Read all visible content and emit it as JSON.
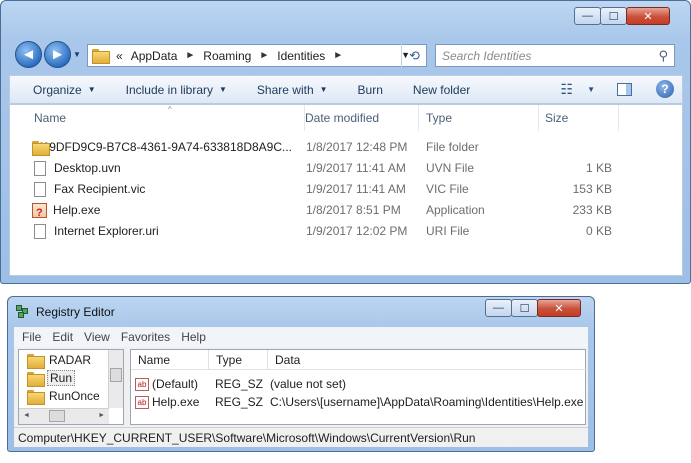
{
  "explorer": {
    "caption_buttons": {
      "minimize": "—",
      "maximize": "☐",
      "close": "✕"
    },
    "nav": {
      "back_glyph": "◄",
      "forward_glyph": "►",
      "dropdown_glyph": "▼"
    },
    "address": {
      "prefix": "«",
      "crumbs": [
        "AppData",
        "Roaming",
        "Identities"
      ],
      "separator": "►",
      "dropdown_glyph": "▼",
      "refresh_glyph": "⟲"
    },
    "search": {
      "placeholder": "Search Identities",
      "icon": "⚲"
    },
    "toolbar": {
      "organize": "Organize",
      "include_in_library": "Include in library",
      "share_with": "Share with",
      "burn": "Burn",
      "new_folder": "New folder",
      "dropdown_glyph": "▼",
      "views_glyph": "☷",
      "help_glyph": "?"
    },
    "columns": {
      "name": "Name",
      "date_modified": "Date modified",
      "type": "Type",
      "size": "Size",
      "sort_indicator": "^"
    },
    "files": [
      {
        "icon": "folder-icon",
        "name": "{69DFD9C9-B7C8-4361-9A74-633818D8A9C...",
        "date": "1/8/2017 12:48 PM",
        "type": "File folder",
        "size": ""
      },
      {
        "icon": "document-icon",
        "name": "Desktop.uvn",
        "date": "1/9/2017 11:41 AM",
        "type": "UVN File",
        "size": "1 KB"
      },
      {
        "icon": "document-icon",
        "name": "Fax Recipient.vic",
        "date": "1/9/2017 11:41 AM",
        "type": "VIC File",
        "size": "153 KB"
      },
      {
        "icon": "application-icon",
        "name": "Help.exe",
        "date": "1/8/2017 8:51 PM",
        "type": "Application",
        "size": "233 KB"
      },
      {
        "icon": "document-icon",
        "name": "Internet Explorer.uri",
        "date": "1/9/2017 12:02 PM",
        "type": "URI File",
        "size": "0 KB"
      }
    ]
  },
  "regedit": {
    "title": "Registry Editor",
    "caption_buttons": {
      "minimize": "—",
      "maximize": "☐",
      "close": "✕"
    },
    "menu": [
      "File",
      "Edit",
      "View",
      "Favorites",
      "Help"
    ],
    "tree": [
      {
        "label": "RADAR",
        "selected": false
      },
      {
        "label": "Run",
        "selected": true
      },
      {
        "label": "RunOnce",
        "selected": false
      }
    ],
    "value_columns": {
      "name": "Name",
      "type": "Type",
      "data": "Data"
    },
    "values": [
      {
        "name": "(Default)",
        "type": "REG_SZ",
        "data": "(value not set)"
      },
      {
        "name": "Help.exe",
        "type": "REG_SZ",
        "data": "C:\\Users\\[username]\\AppData\\Roaming\\Identities\\Help.exe"
      }
    ],
    "string_value_icon_text": "ab",
    "status_path": "Computer\\HKEY_CURRENT_USER\\Software\\Microsoft\\Windows\\CurrentVersion\\Run"
  }
}
